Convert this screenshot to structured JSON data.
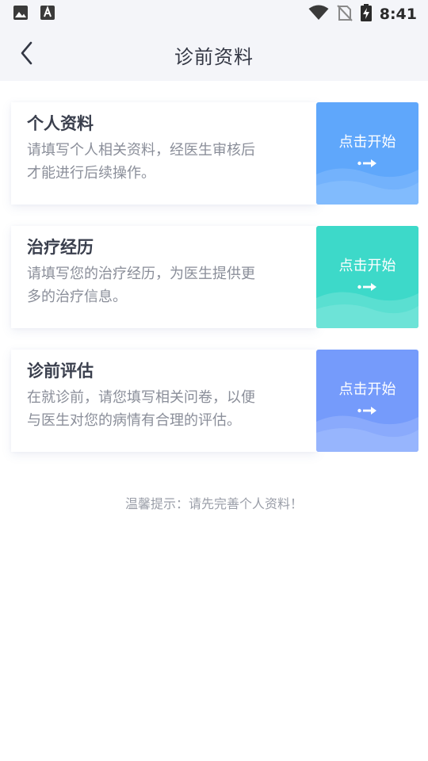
{
  "status_bar": {
    "time": "8:41",
    "left_icons": [
      "image-icon",
      "font-download-icon"
    ],
    "right_icons": [
      "wifi-icon",
      "no-sim-icon",
      "battery-charging-icon"
    ]
  },
  "nav": {
    "back_icon": "chevron-left-icon",
    "title": "诊前资料"
  },
  "cards": [
    {
      "title": "个人资料",
      "desc_lines": [
        "请填写个人相关资料，经医生审核后",
        "才能进行后续操作。"
      ],
      "button_label": "点击开始",
      "button_color": "#5fa7fb",
      "wave_color": "#8cc2fd"
    },
    {
      "title": "治疗经历",
      "desc_lines": [
        "请填写您的治疗经历，为医生提供更",
        "多的治疗信息。"
      ],
      "button_label": "点击开始",
      "button_color": "#3dd9c9",
      "wave_color": "#7ee6dc"
    },
    {
      "title": "诊前评估",
      "desc_lines": [
        "在就诊前，请您填写相关问卷，以便",
        "与医生对您的病情有合理的评估。"
      ],
      "button_label": "点击开始",
      "button_color": "#759bfb",
      "wave_color": "#a3bdfd"
    }
  ],
  "hint": "温馨提示：请先完善个人资料！"
}
